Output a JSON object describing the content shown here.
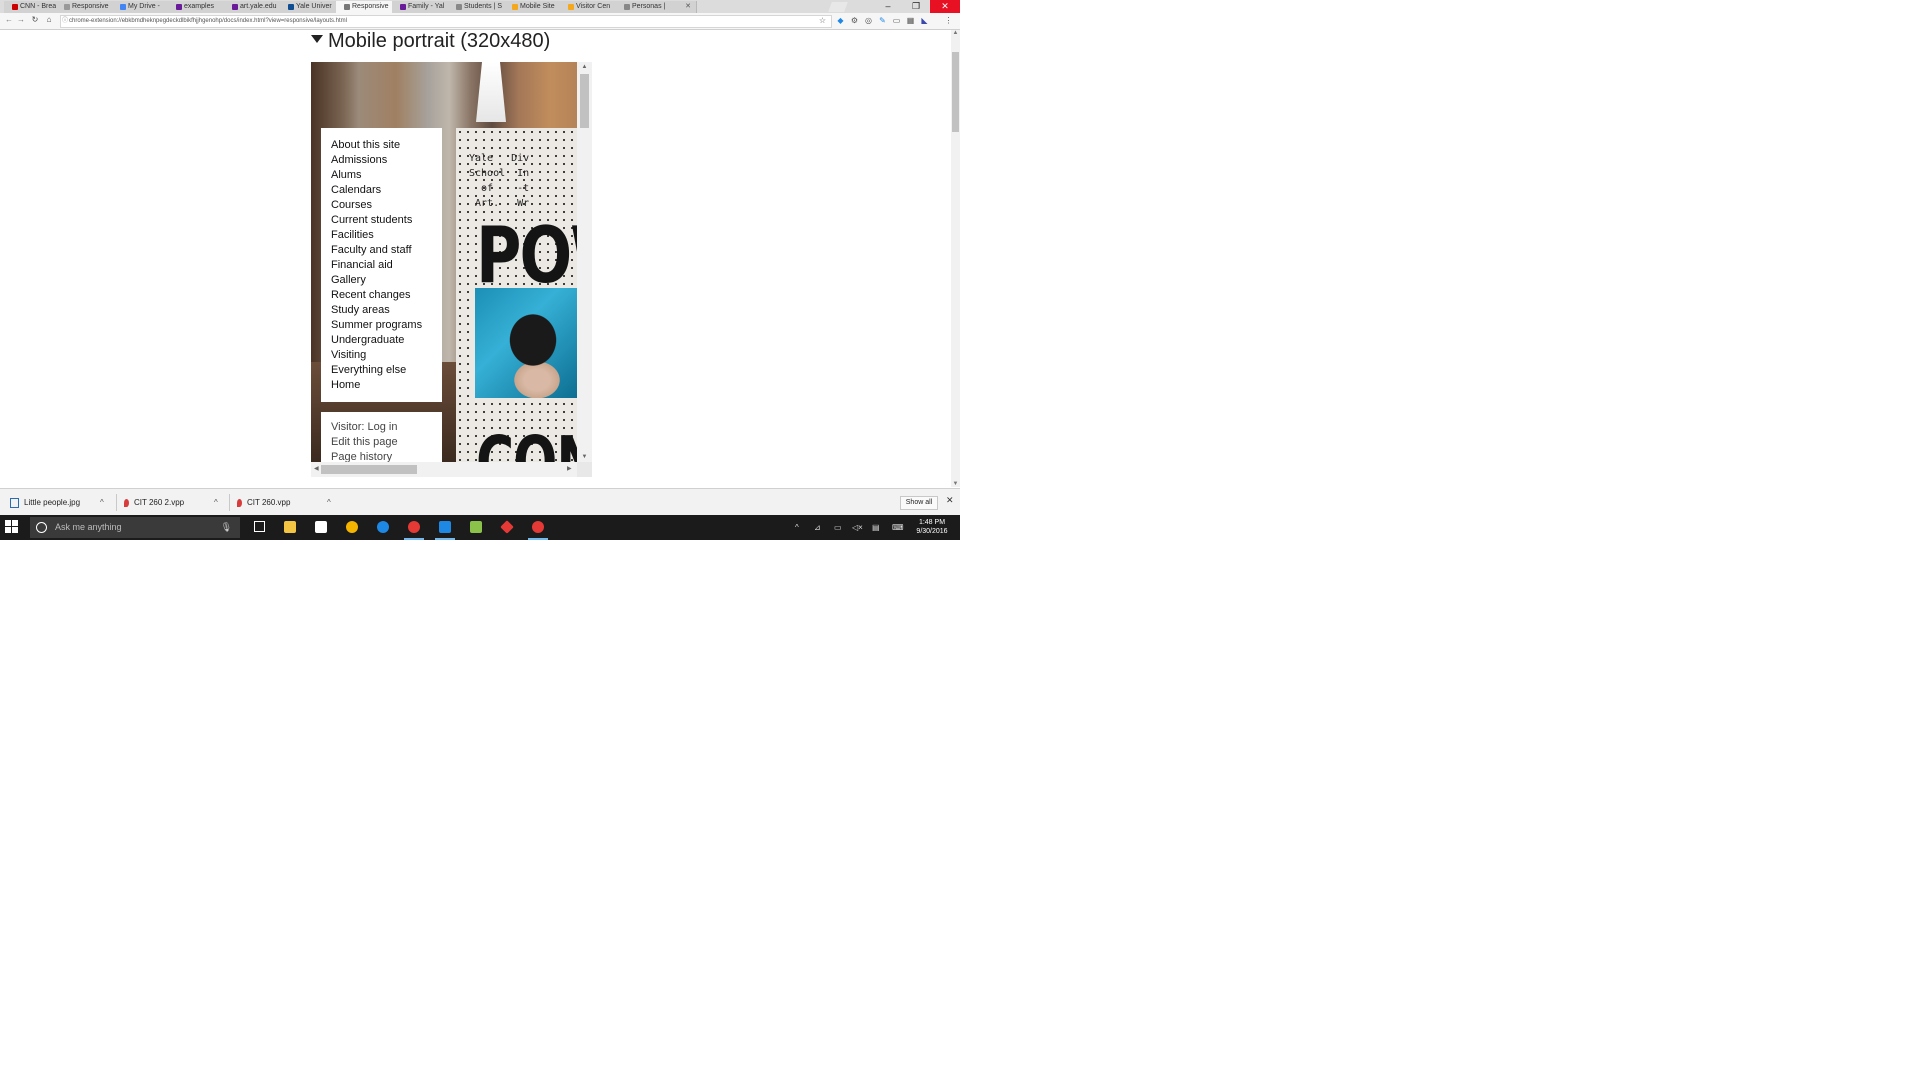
{
  "browser": {
    "tabs": [
      {
        "label": "CNN - Brea",
        "favicon_color": "#cc0000"
      },
      {
        "label": "Responsive",
        "favicon_color": "#999999"
      },
      {
        "label": "My Drive -",
        "favicon_color": "#4285f4"
      },
      {
        "label": "examples",
        "favicon_color": "#6a1b9a"
      },
      {
        "label": "art.yale.edu",
        "favicon_color": "#6a1b9a"
      },
      {
        "label": "Yale Univer",
        "favicon_color": "#0f4d92"
      },
      {
        "label": "Responsive",
        "favicon_color": "#777777",
        "active": true
      },
      {
        "label": "Family - Yal",
        "favicon_color": "#6a1b9a"
      },
      {
        "label": "Students | S",
        "favicon_color": "#888888"
      },
      {
        "label": "Mobile Site",
        "favicon_color": "#f4a81d"
      },
      {
        "label": "Visitor Cen",
        "favicon_color": "#f4a81d"
      },
      {
        "label": "Personas |",
        "favicon_color": "#888888"
      }
    ],
    "url": "chrome-extension://ebkbmdheknpegdeckdlbikfhjjhgenohp/docs/index.html?view=responsive/layouts.html",
    "window_controls": {
      "minimize": "–",
      "restore": "❐",
      "close": "✕"
    }
  },
  "page": {
    "section_heading": "Mobile portrait (320x480)",
    "nav_items": [
      "About this site",
      "Admissions",
      "Alums",
      "Calendars",
      "Courses",
      "Current students",
      "Facilities",
      "Faculty and staff",
      "Financial aid",
      "Gallery",
      "Recent changes",
      "Study areas",
      "Summer programs",
      "Undergraduate",
      "Visiting",
      "Everything else",
      "Home"
    ],
    "user_links": [
      "Visitor: Log in",
      "Edit this page",
      "Page history"
    ],
    "poster": {
      "header_text": "Yale   Div\nSchool  In\n  of    -t\n Art.   Wr",
      "word_top": "POW",
      "word_bottom": "CON¢"
    }
  },
  "downloads": {
    "items": [
      {
        "name": "Little people.jpg",
        "icon_color": "#2b6cb0"
      },
      {
        "name": "CIT 260 2.vpp",
        "icon_color": "#d83b3b"
      },
      {
        "name": "CIT 260.vpp",
        "icon_color": "#d83b3b"
      }
    ],
    "show_all": "Show all"
  },
  "taskbar": {
    "search_placeholder": "Ask me anything",
    "time": "1:48 PM",
    "date": "9/30/2016",
    "apps": [
      {
        "name": "task-view",
        "color": "#ffffff"
      },
      {
        "name": "file-explorer",
        "color": "#f4c542"
      },
      {
        "name": "store",
        "color": "#ffffff"
      },
      {
        "name": "chrome-canary",
        "color": "#f4b400"
      },
      {
        "name": "edge",
        "color": "#1e88e5"
      },
      {
        "name": "chrome",
        "color": "#e53935",
        "open": true
      },
      {
        "name": "app-blue",
        "color": "#1e88e5",
        "open": true
      },
      {
        "name": "photos",
        "color": "#8bc34a"
      },
      {
        "name": "app-red",
        "color": "#e53935"
      },
      {
        "name": "chrome-2",
        "color": "#e53935",
        "open": true
      }
    ]
  }
}
